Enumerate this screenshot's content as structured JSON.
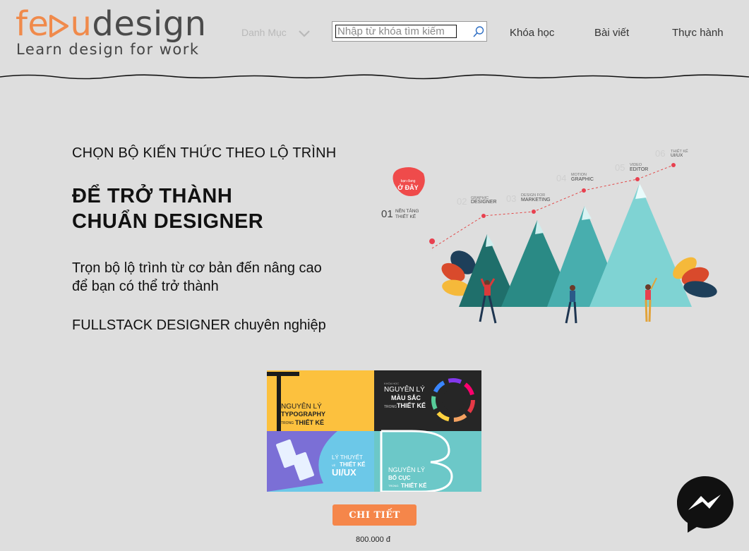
{
  "logo": {
    "part1": "fe",
    "part2": "u",
    "part3": "design",
    "tagline": "Learn design for work"
  },
  "header": {
    "menu_label": "Danh Mục",
    "search_placeholder": "Nhập từ khóa tìm kiếm",
    "nav": [
      "Khóa học",
      "Bài viết",
      "Thực hành"
    ]
  },
  "hero": {
    "subtitle": "CHỌN BỘ KIẾN THỨC THEO LỘ TRÌNH",
    "title_line1": "ĐỂ TRỞ THÀNH",
    "title_line2": "CHUẨN DESIGNER",
    "desc_line1": "Trọn bộ lộ trình từ cơ bản đến nâng cao",
    "desc_line2": "để bạn có thể trở thành",
    "desc_line3": "FULLSTACK DESIGNER chuyên nghiệp"
  },
  "roadmap": {
    "badge_top": "bạn đang",
    "badge_main": "Ở ĐÂY",
    "steps": [
      {
        "num": "01",
        "l1": "NỀN TẢNG",
        "l2": "THIẾT KẾ"
      },
      {
        "num": "02",
        "l1": "GRAPHIC",
        "l2": "DESIGNER"
      },
      {
        "num": "03",
        "l1": "DESIGN FOR",
        "l2": "MARKETING"
      },
      {
        "num": "04",
        "l1": "MOTION",
        "l2": "GRAPHIC"
      },
      {
        "num": "05",
        "l1": "VIDEO",
        "l2": "EDITOR"
      },
      {
        "num": "06",
        "l1": "THIẾT KẾ",
        "l2": "UI/UX"
      }
    ]
  },
  "course": {
    "tiles": [
      {
        "l1": "NGUYÊN LÝ",
        "l2": "TYPOGRAPHY",
        "l3": "TRONG",
        "l4": "THIẾT KẾ"
      },
      {
        "l0": "KHÓA HỌC",
        "l1": "NGUYÊN LÝ",
        "l2": "MÀU SẮC",
        "l3": "TRONG",
        "l4": "THIẾT KẾ"
      },
      {
        "l1": "LÝ THUYẾT",
        "l2": "VỀ",
        "l3": "THIẾT KẾ",
        "l4": "UI/UX"
      },
      {
        "l1": "NGUYÊN LÝ",
        "l2": "BỐ CỤC",
        "l3": "TRONG",
        "l4": "THIẾT KẾ"
      }
    ],
    "button_label": "CHI TIẾT",
    "price": "800.000 đ"
  },
  "colors": {
    "accent": "#f5864a",
    "background": "#dedede",
    "mountain_dark": "#1f7a75",
    "mountain_light": "#7fd3d3"
  },
  "icons": {
    "search": "search-icon",
    "menu_chevron": "chevron-down-icon",
    "chat": "messenger-icon",
    "logo_glyph": "play-triangle-icon"
  }
}
